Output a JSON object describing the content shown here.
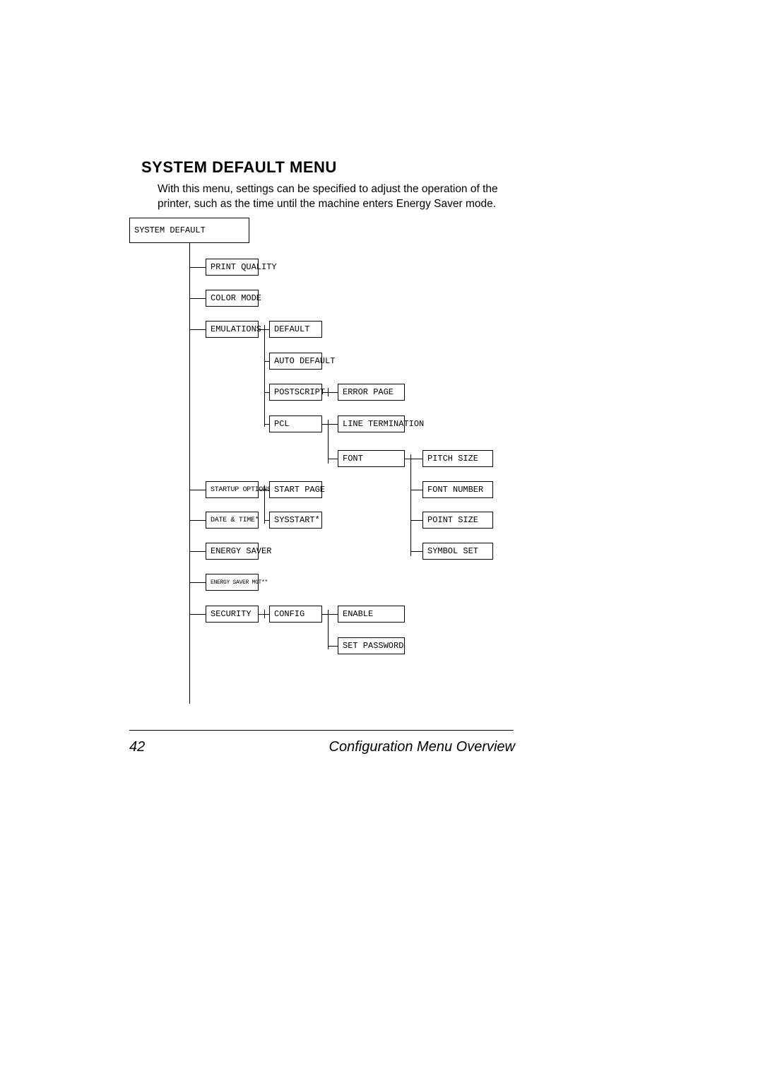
{
  "heading": "SYSTEM DEFAULT MENU",
  "intro": "With this menu, settings can be specified to adjust the operation of the printer, such as the time until the machine enters Energy Saver mode.",
  "footer": {
    "page": "42",
    "title": "Configuration Menu Overview"
  },
  "tree": {
    "root": "SYSTEM DEFAULT",
    "level1": {
      "print_quality": "PRINT QUALITY",
      "color_mode": "COLOR MODE",
      "emulations": "EMULATIONS",
      "startup_options": "STARTUP OPTIONS",
      "date_time": "DATE & TIME*",
      "energy_saver": "ENERGY SAVER",
      "energy_saver_mgt": "ENERGY SAVER MGT**",
      "security": "SECURITY"
    },
    "emulations_children": {
      "default": "DEFAULT",
      "auto_default": "AUTO DEFAULT",
      "postscript": "POSTSCRIPT",
      "pcl": "PCL"
    },
    "startup_children": {
      "start_page": "START PAGE",
      "sysstart": "SYSSTART*"
    },
    "postscript_children": {
      "error_page": "ERROR PAGE"
    },
    "pcl_children": {
      "line_termination": "LINE TERMINATION",
      "font": "FONT"
    },
    "font_children": {
      "pitch_size": "PITCH SIZE",
      "font_number": "FONT NUMBER",
      "point_size": "POINT SIZE",
      "symbol_set": "SYMBOL SET"
    },
    "security_children": {
      "config": "CONFIG"
    },
    "config_children": {
      "enable": "ENABLE",
      "set_password": "SET PASSWORD"
    }
  }
}
